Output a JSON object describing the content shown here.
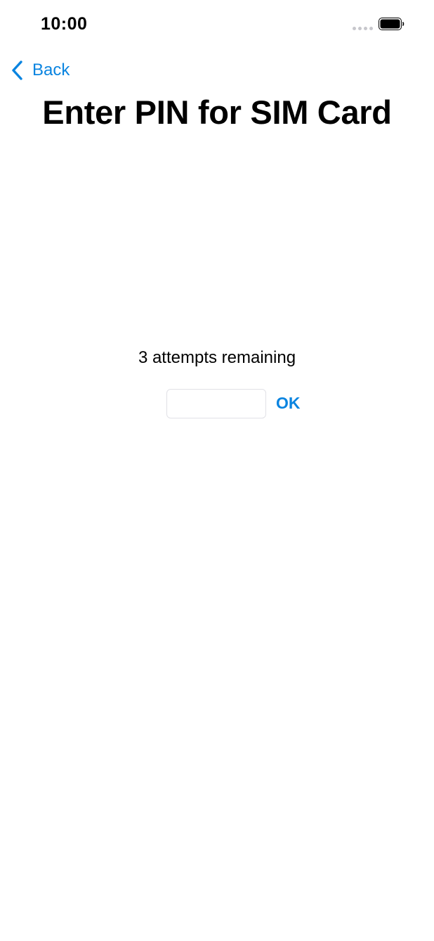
{
  "status_bar": {
    "time": "10:00"
  },
  "nav": {
    "back_label": "Back"
  },
  "page": {
    "title": "Enter PIN for SIM Card",
    "attempts_text": "3 attempts remaining"
  },
  "pin_field": {
    "value": "",
    "placeholder": ""
  },
  "actions": {
    "ok_label": "OK"
  },
  "colors": {
    "accent": "#0a84e0",
    "text": "#000000",
    "background": "#ffffff",
    "field_border": "#e1e1e6"
  }
}
